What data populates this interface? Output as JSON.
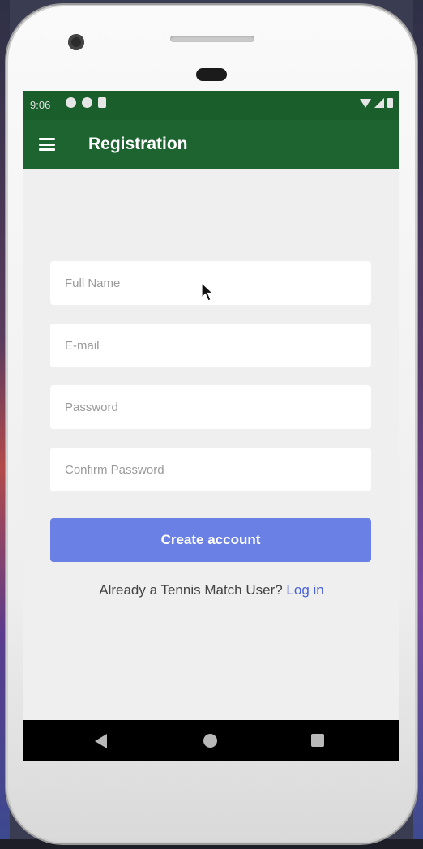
{
  "status_bar": {
    "time": "9:06"
  },
  "app_bar": {
    "title": "Registration",
    "menu_icon": "hamburger-menu-icon"
  },
  "form": {
    "full_name": {
      "placeholder": "Full Name",
      "value": ""
    },
    "email": {
      "placeholder": "E-mail",
      "value": ""
    },
    "password": {
      "placeholder": "Password",
      "value": ""
    },
    "confirm_password": {
      "placeholder": "Confirm Password",
      "value": ""
    },
    "submit_label": "Create account"
  },
  "login_prompt": {
    "text": "Already a Tennis Match User? ",
    "link": "Log in"
  },
  "colors": {
    "status_bar": "#1a5e2b",
    "app_bar": "#1e6430",
    "button": "#6b80e5",
    "link": "#4a62d8",
    "background": "#efefef"
  }
}
